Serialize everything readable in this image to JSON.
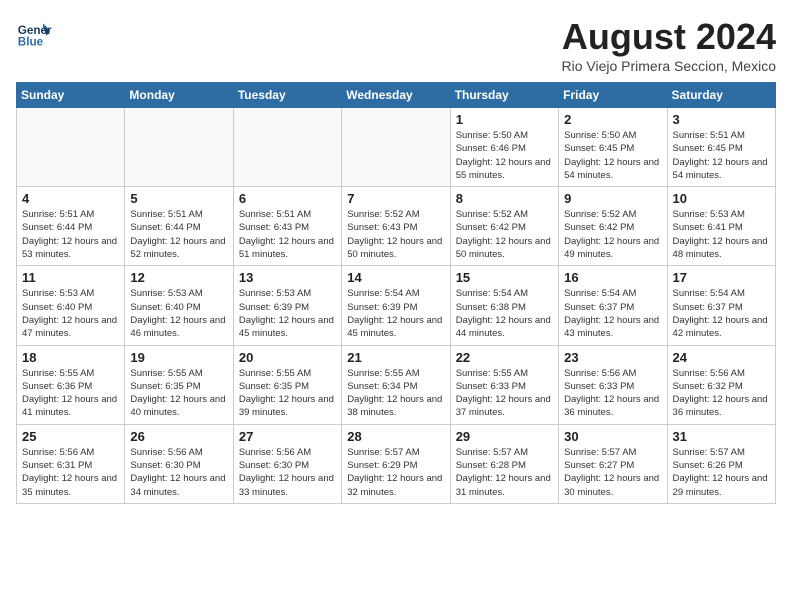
{
  "header": {
    "logo_line1": "General",
    "logo_line2": "Blue",
    "month_title": "August 2024",
    "location": "Rio Viejo Primera Seccion, Mexico"
  },
  "days_of_week": [
    "Sunday",
    "Monday",
    "Tuesday",
    "Wednesday",
    "Thursday",
    "Friday",
    "Saturday"
  ],
  "weeks": [
    [
      {
        "day": "",
        "info": ""
      },
      {
        "day": "",
        "info": ""
      },
      {
        "day": "",
        "info": ""
      },
      {
        "day": "",
        "info": ""
      },
      {
        "day": "1",
        "info": "Sunrise: 5:50 AM\nSunset: 6:46 PM\nDaylight: 12 hours\nand 55 minutes."
      },
      {
        "day": "2",
        "info": "Sunrise: 5:50 AM\nSunset: 6:45 PM\nDaylight: 12 hours\nand 54 minutes."
      },
      {
        "day": "3",
        "info": "Sunrise: 5:51 AM\nSunset: 6:45 PM\nDaylight: 12 hours\nand 54 minutes."
      }
    ],
    [
      {
        "day": "4",
        "info": "Sunrise: 5:51 AM\nSunset: 6:44 PM\nDaylight: 12 hours\nand 53 minutes."
      },
      {
        "day": "5",
        "info": "Sunrise: 5:51 AM\nSunset: 6:44 PM\nDaylight: 12 hours\nand 52 minutes."
      },
      {
        "day": "6",
        "info": "Sunrise: 5:51 AM\nSunset: 6:43 PM\nDaylight: 12 hours\nand 51 minutes."
      },
      {
        "day": "7",
        "info": "Sunrise: 5:52 AM\nSunset: 6:43 PM\nDaylight: 12 hours\nand 50 minutes."
      },
      {
        "day": "8",
        "info": "Sunrise: 5:52 AM\nSunset: 6:42 PM\nDaylight: 12 hours\nand 50 minutes."
      },
      {
        "day": "9",
        "info": "Sunrise: 5:52 AM\nSunset: 6:42 PM\nDaylight: 12 hours\nand 49 minutes."
      },
      {
        "day": "10",
        "info": "Sunrise: 5:53 AM\nSunset: 6:41 PM\nDaylight: 12 hours\nand 48 minutes."
      }
    ],
    [
      {
        "day": "11",
        "info": "Sunrise: 5:53 AM\nSunset: 6:40 PM\nDaylight: 12 hours\nand 47 minutes."
      },
      {
        "day": "12",
        "info": "Sunrise: 5:53 AM\nSunset: 6:40 PM\nDaylight: 12 hours\nand 46 minutes."
      },
      {
        "day": "13",
        "info": "Sunrise: 5:53 AM\nSunset: 6:39 PM\nDaylight: 12 hours\nand 45 minutes."
      },
      {
        "day": "14",
        "info": "Sunrise: 5:54 AM\nSunset: 6:39 PM\nDaylight: 12 hours\nand 45 minutes."
      },
      {
        "day": "15",
        "info": "Sunrise: 5:54 AM\nSunset: 6:38 PM\nDaylight: 12 hours\nand 44 minutes."
      },
      {
        "day": "16",
        "info": "Sunrise: 5:54 AM\nSunset: 6:37 PM\nDaylight: 12 hours\nand 43 minutes."
      },
      {
        "day": "17",
        "info": "Sunrise: 5:54 AM\nSunset: 6:37 PM\nDaylight: 12 hours\nand 42 minutes."
      }
    ],
    [
      {
        "day": "18",
        "info": "Sunrise: 5:55 AM\nSunset: 6:36 PM\nDaylight: 12 hours\nand 41 minutes."
      },
      {
        "day": "19",
        "info": "Sunrise: 5:55 AM\nSunset: 6:35 PM\nDaylight: 12 hours\nand 40 minutes."
      },
      {
        "day": "20",
        "info": "Sunrise: 5:55 AM\nSunset: 6:35 PM\nDaylight: 12 hours\nand 39 minutes."
      },
      {
        "day": "21",
        "info": "Sunrise: 5:55 AM\nSunset: 6:34 PM\nDaylight: 12 hours\nand 38 minutes."
      },
      {
        "day": "22",
        "info": "Sunrise: 5:55 AM\nSunset: 6:33 PM\nDaylight: 12 hours\nand 37 minutes."
      },
      {
        "day": "23",
        "info": "Sunrise: 5:56 AM\nSunset: 6:33 PM\nDaylight: 12 hours\nand 36 minutes."
      },
      {
        "day": "24",
        "info": "Sunrise: 5:56 AM\nSunset: 6:32 PM\nDaylight: 12 hours\nand 36 minutes."
      }
    ],
    [
      {
        "day": "25",
        "info": "Sunrise: 5:56 AM\nSunset: 6:31 PM\nDaylight: 12 hours\nand 35 minutes."
      },
      {
        "day": "26",
        "info": "Sunrise: 5:56 AM\nSunset: 6:30 PM\nDaylight: 12 hours\nand 34 minutes."
      },
      {
        "day": "27",
        "info": "Sunrise: 5:56 AM\nSunset: 6:30 PM\nDaylight: 12 hours\nand 33 minutes."
      },
      {
        "day": "28",
        "info": "Sunrise: 5:57 AM\nSunset: 6:29 PM\nDaylight: 12 hours\nand 32 minutes."
      },
      {
        "day": "29",
        "info": "Sunrise: 5:57 AM\nSunset: 6:28 PM\nDaylight: 12 hours\nand 31 minutes."
      },
      {
        "day": "30",
        "info": "Sunrise: 5:57 AM\nSunset: 6:27 PM\nDaylight: 12 hours\nand 30 minutes."
      },
      {
        "day": "31",
        "info": "Sunrise: 5:57 AM\nSunset: 6:26 PM\nDaylight: 12 hours\nand 29 minutes."
      }
    ]
  ]
}
